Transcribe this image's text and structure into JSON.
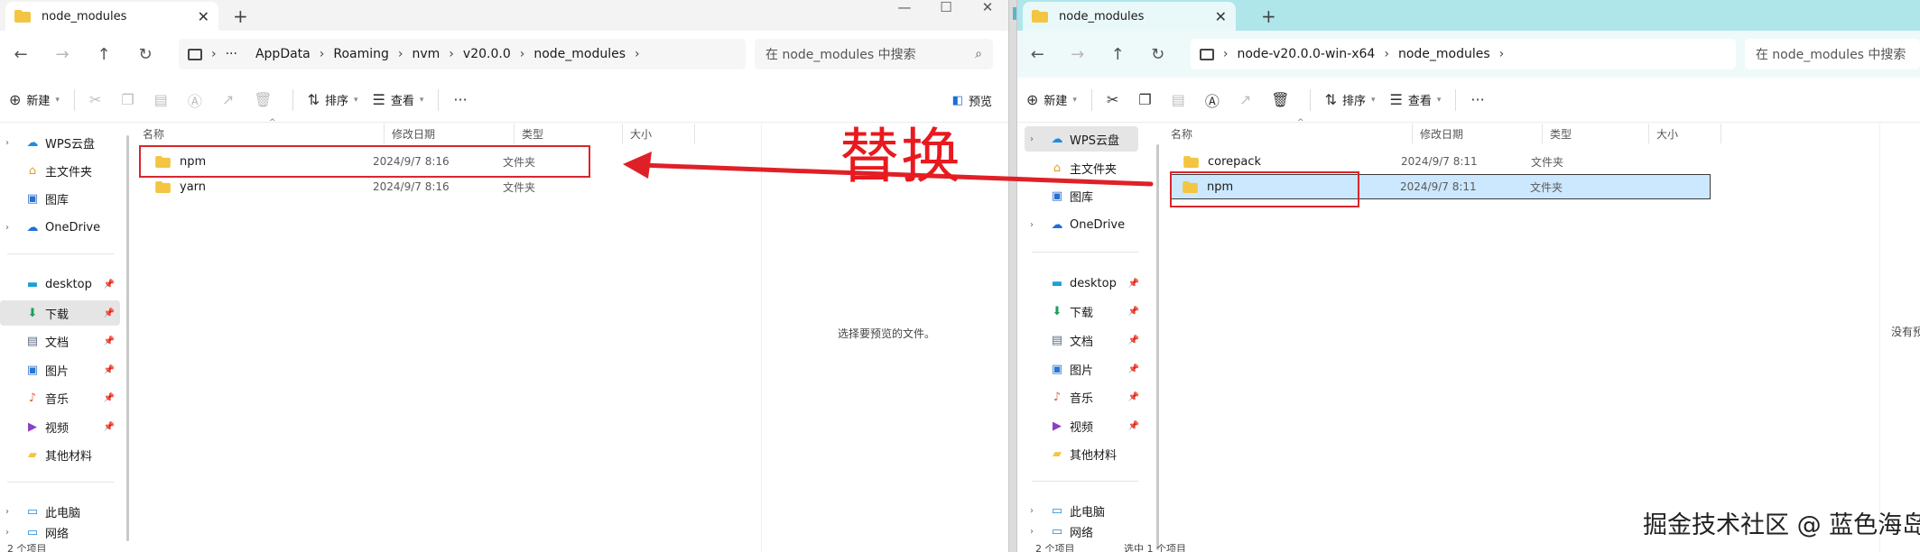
{
  "left_window": {
    "tab_title": "node_modules",
    "breadcrumb": [
      "AppData",
      "Roaming",
      "nvm",
      "v20.0.0",
      "node_modules"
    ],
    "search_placeholder": "在 node_modules 中搜索",
    "toolbar": {
      "new_label": "新建",
      "sort_label": "排序",
      "view_label": "查看",
      "preview_label": "预览"
    },
    "columns": [
      "名称",
      "修改日期",
      "类型",
      "大小"
    ],
    "files": [
      {
        "name": "npm",
        "date": "2024/9/7 8:16",
        "type": "文件夹"
      },
      {
        "name": "yarn",
        "date": "2024/9/7 8:16",
        "type": "文件夹"
      }
    ],
    "preview_message": "选择要预览的文件。",
    "status": "2 个项目",
    "sidebar": [
      {
        "label": "WPS云盘"
      },
      {
        "label": "主文件夹"
      },
      {
        "label": "图库"
      },
      {
        "label": "OneDrive"
      },
      {
        "label": "desktop"
      },
      {
        "label": "下载"
      },
      {
        "label": "文档"
      },
      {
        "label": "图片"
      },
      {
        "label": "音乐"
      },
      {
        "label": "视频"
      },
      {
        "label": "其他材料"
      },
      {
        "label": "此电脑"
      },
      {
        "label": "网络"
      }
    ]
  },
  "right_window": {
    "tab_title": "node_modules",
    "breadcrumb": [
      "node-v20.0.0-win-x64",
      "node_modules"
    ],
    "search_placeholder": "在 node_modules 中搜索",
    "toolbar": {
      "new_label": "新建",
      "sort_label": "排序",
      "view_label": "查看"
    },
    "columns": [
      "名称",
      "修改日期",
      "类型",
      "大小"
    ],
    "files": [
      {
        "name": "corepack",
        "date": "2024/9/7 8:11",
        "type": "文件夹"
      },
      {
        "name": "npm",
        "date": "2024/9/7 8:11",
        "type": "文件夹"
      }
    ],
    "preview_message": "没有预",
    "status_items": "2 个项目",
    "status_selected": "选中 1 个项目",
    "sidebar": [
      {
        "label": "WPS云盘"
      },
      {
        "label": "主文件夹"
      },
      {
        "label": "图库"
      },
      {
        "label": "OneDrive"
      },
      {
        "label": "desktop"
      },
      {
        "label": "下载"
      },
      {
        "label": "文档"
      },
      {
        "label": "图片"
      },
      {
        "label": "音乐"
      },
      {
        "label": "视频"
      },
      {
        "label": "其他材料"
      },
      {
        "label": "此电脑"
      },
      {
        "label": "网络"
      }
    ]
  },
  "annotation": {
    "text": "替换",
    "color": "#e8191f"
  },
  "watermark": "掘金技术社区 @ 蓝色海岛",
  "colors": {
    "folder": "#f4c542",
    "selection": "#cce8ff",
    "right_titlebar": "#aee6ea"
  }
}
